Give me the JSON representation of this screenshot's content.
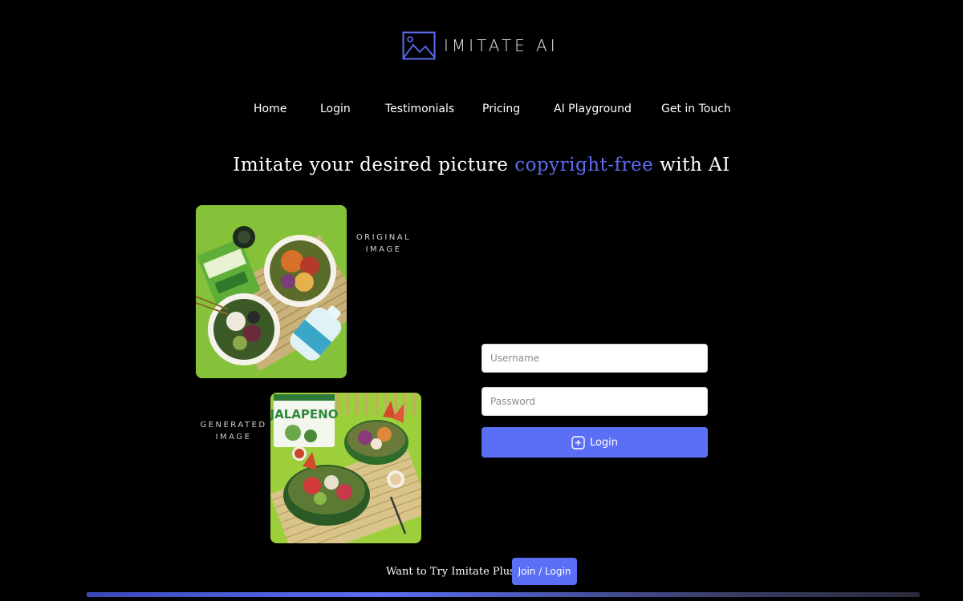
{
  "brand": {
    "name": "IMITATE  AI",
    "logo_icon": "mountain-image-icon",
    "accent": "#5b6cf0"
  },
  "nav": [
    {
      "label": "Home"
    },
    {
      "label": "Login"
    },
    {
      "label": "Testimonials"
    },
    {
      "label": "Pricing"
    },
    {
      "label": "AI Playground"
    },
    {
      "label": "Get in Touch"
    }
  ],
  "hero": {
    "headline_before": "Imitate your desired picture",
    "headline_accent": "copyright-free",
    "headline_after": "with AI"
  },
  "images": {
    "original_caption": "ORIGINAL IMAGE",
    "generated_caption": "GENERATED IMAGE",
    "generated_bag_text": "JALAPENO"
  },
  "login_form": {
    "username_placeholder": "Username",
    "password_placeholder": "Password",
    "submit_label": "Login",
    "submit_icon": "plus-square-icon"
  },
  "cta": {
    "text": "Want to Try Imitate Plus?",
    "button_label": "Join  /  Login"
  },
  "colors": {
    "background": "#000000",
    "button": "#5a6ff5"
  }
}
